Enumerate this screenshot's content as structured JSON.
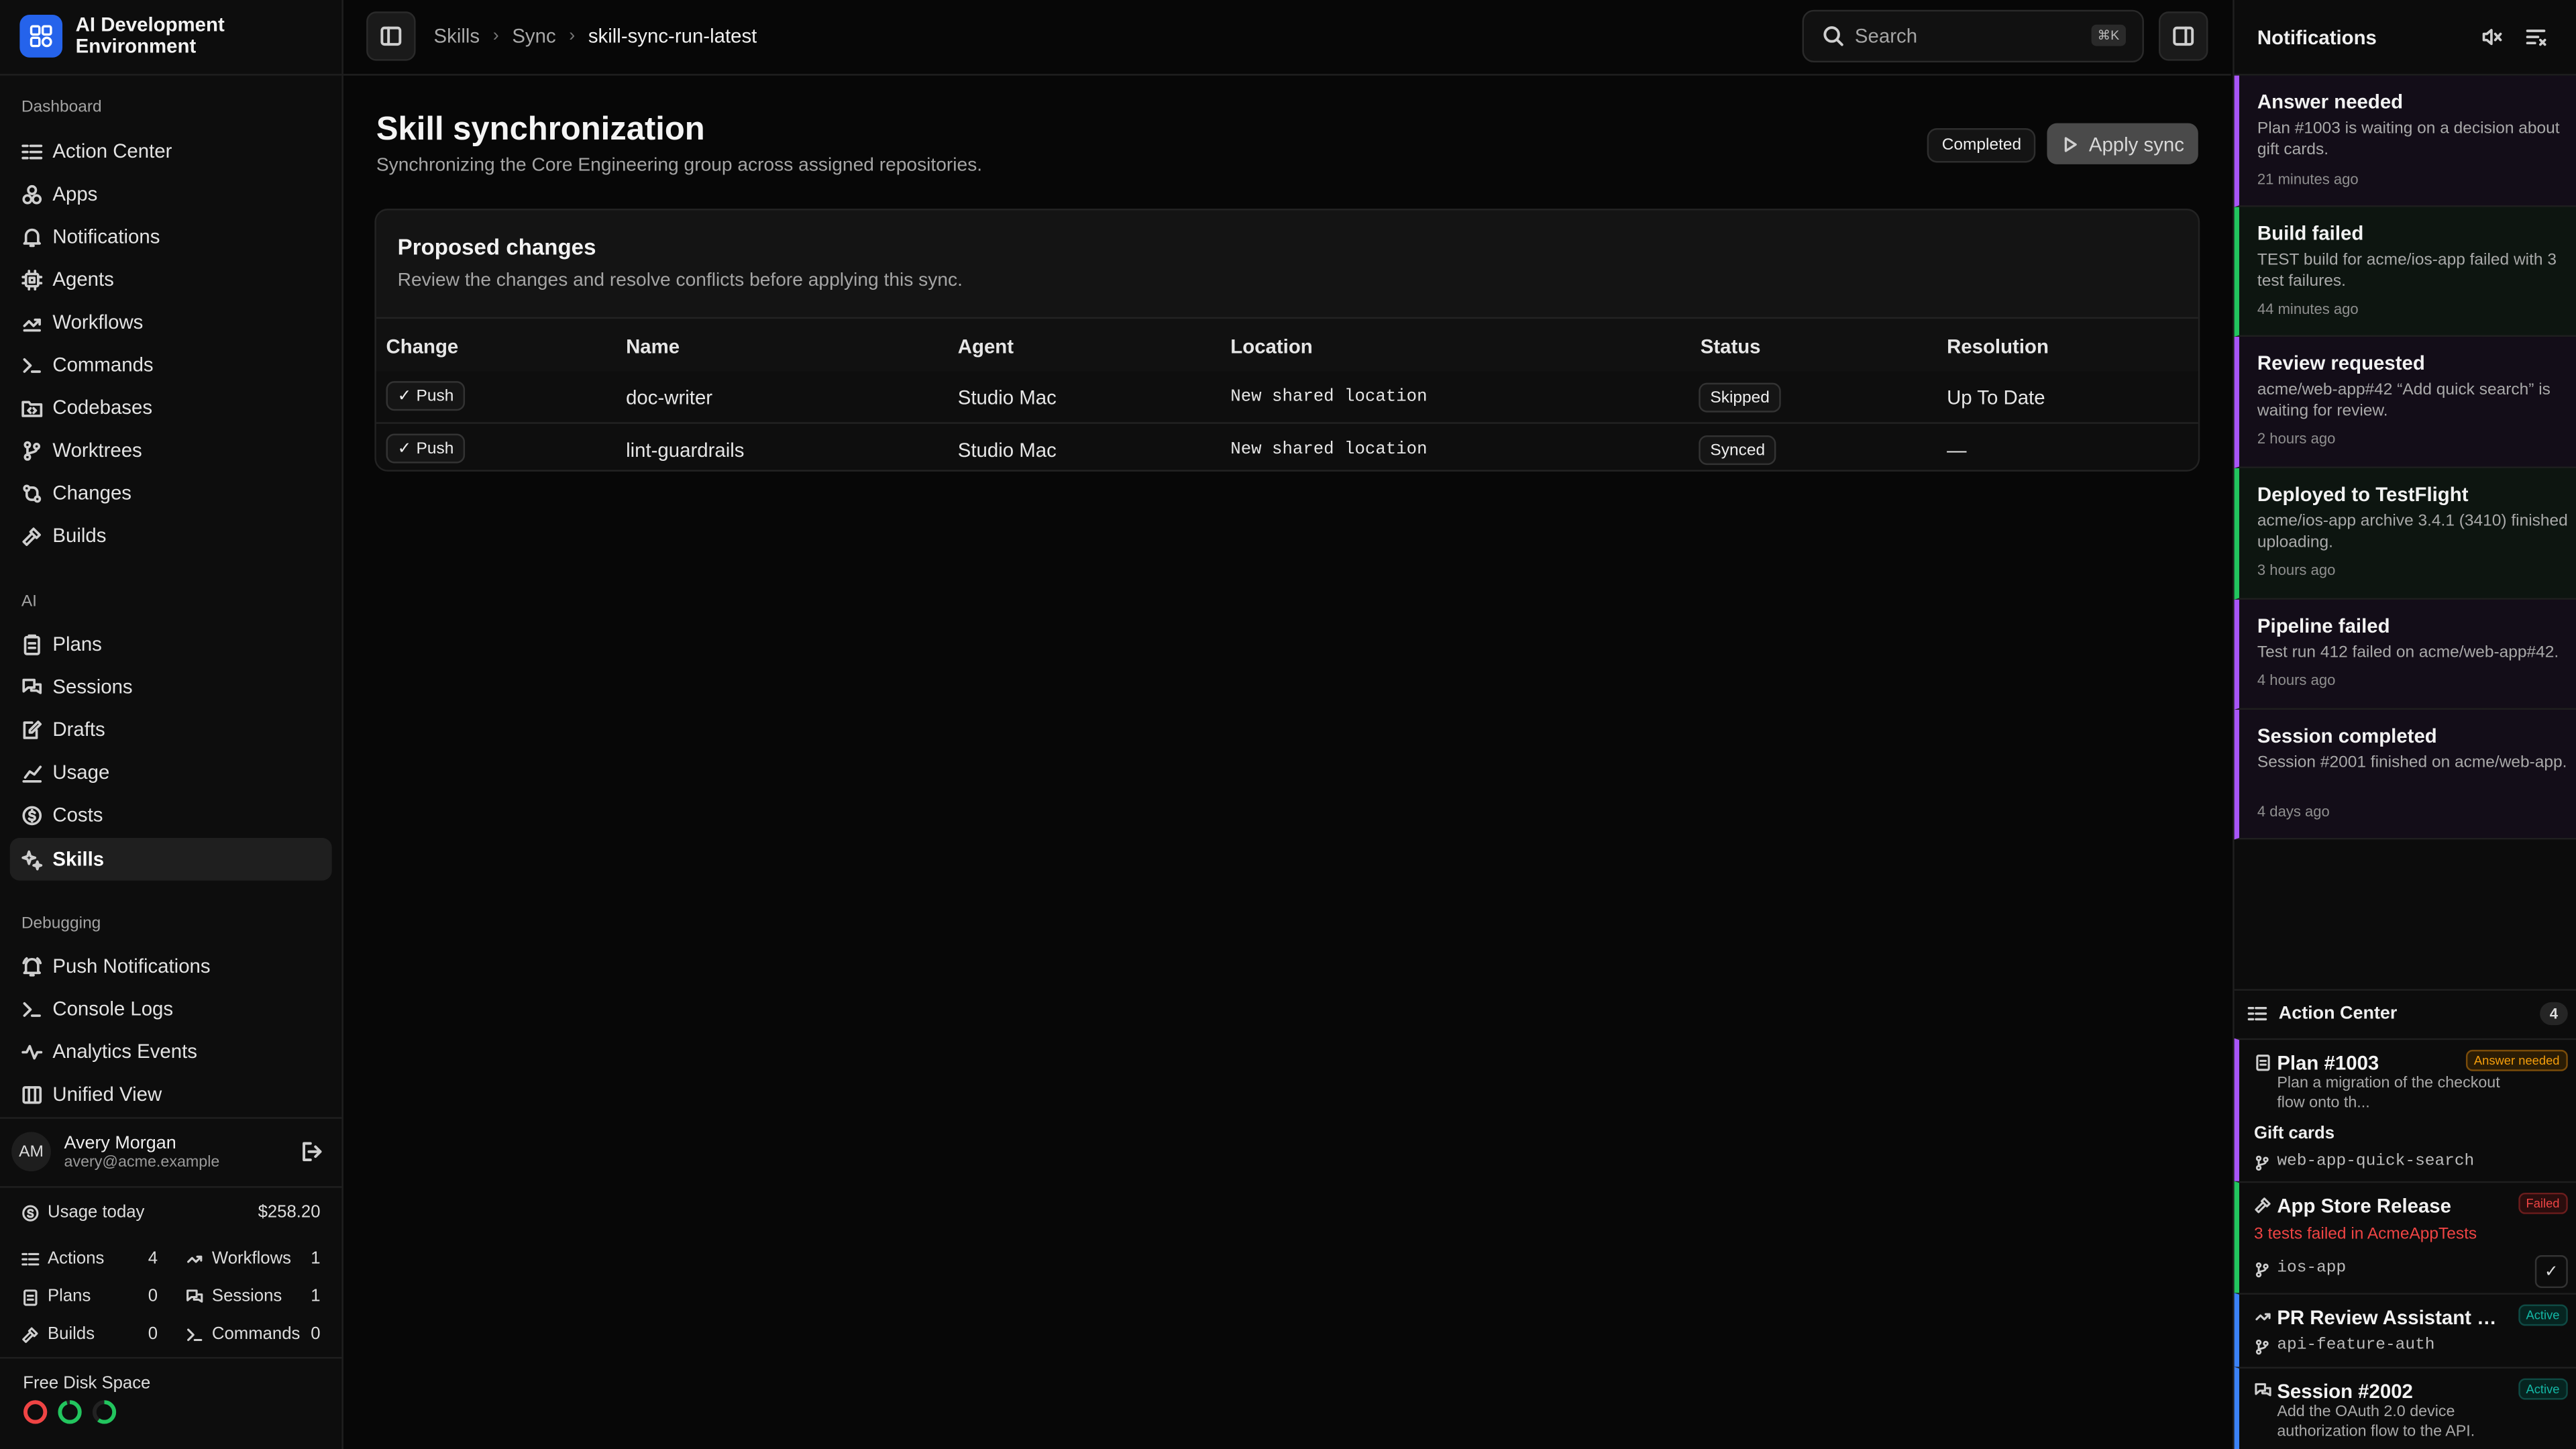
{
  "app": {
    "name": "AI Development Environment"
  },
  "sidebar": {
    "sections": [
      {
        "label": "Dashboard",
        "items": [
          "Action Center",
          "Apps",
          "Notifications",
          "Agents",
          "Workflows",
          "Commands",
          "Codebases",
          "Worktrees",
          "Changes",
          "Builds"
        ]
      },
      {
        "label": "AI",
        "items": [
          "Plans",
          "Sessions",
          "Drafts",
          "Usage",
          "Costs",
          "Skills"
        ]
      },
      {
        "label": "Debugging",
        "items": [
          "Push Notifications",
          "Console Logs",
          "Analytics Events",
          "Unified View"
        ]
      }
    ],
    "active": "Skills"
  },
  "user": {
    "initials": "AM",
    "name": "Avery Morgan",
    "email": "avery@acme.example"
  },
  "usage": {
    "label": "Usage today",
    "value": "$258.20",
    "stats": [
      {
        "label": "Actions",
        "value": "4"
      },
      {
        "label": "Workflows",
        "value": "1"
      },
      {
        "label": "Plans",
        "value": "0"
      },
      {
        "label": "Sessions",
        "value": "1"
      },
      {
        "label": "Builds",
        "value": "0"
      },
      {
        "label": "Commands",
        "value": "0"
      }
    ]
  },
  "disk": {
    "label": "Free Disk Space",
    "rings": [
      {
        "color": "#ef4444",
        "fraction": 1.0
      },
      {
        "color": "#22c55e",
        "fraction": 0.95
      },
      {
        "color": "#22c55e",
        "fraction": 0.6
      }
    ]
  },
  "breadcrumbs": [
    "Skills",
    "Sync",
    "skill-sync-run-latest"
  ],
  "search": {
    "placeholder": "Search",
    "shortcut": "⌘K"
  },
  "page": {
    "title": "Skill synchronization",
    "subtitle": "Synchronizing the Core Engineering group across assigned repositories.",
    "status": "Completed",
    "apply_label": "Apply sync"
  },
  "changes": {
    "title": "Proposed changes",
    "description": "Review the changes and resolve conflicts before applying this sync.",
    "columns": [
      "Change",
      "Name",
      "Agent",
      "Location",
      "Status",
      "Resolution"
    ],
    "rows": [
      {
        "change": "Push",
        "name": "doc-writer",
        "agent": "Studio Mac",
        "location": "New shared location",
        "status": "Skipped",
        "resolution": "Up To Date"
      },
      {
        "change": "Push",
        "name": "lint-guardrails",
        "agent": "Studio Mac",
        "location": "New shared location",
        "status": "Synced",
        "resolution": "—"
      }
    ]
  },
  "notifications": {
    "title": "Notifications",
    "items": [
      {
        "title": "Answer needed",
        "desc": "Plan #1003 is waiting on a decision about gift cards.",
        "age": "21 minutes ago",
        "color": "#a855f7"
      },
      {
        "title": "Build failed",
        "desc": "TEST build for acme/ios-app failed with 3 test failures.",
        "age": "44 minutes ago",
        "color": "#22c55e"
      },
      {
        "title": "Review requested",
        "desc": "acme/web-app#42 “Add quick search” is waiting for review.",
        "age": "2 hours ago",
        "color": "#a855f7"
      },
      {
        "title": "Deployed to TestFlight",
        "desc": "acme/ios-app archive 3.4.1 (3410) finished uploading.",
        "age": "3 hours ago",
        "color": "#22c55e"
      },
      {
        "title": "Pipeline failed",
        "desc": "Test run 412 failed on acme/web-app#42.",
        "age": "4 hours ago",
        "color": "#a855f7"
      },
      {
        "title": "Session completed",
        "desc": "Session #2001 finished on acme/web-app.",
        "age": "4 days ago",
        "color": "#a855f7"
      }
    ]
  },
  "action_center": {
    "title": "Action Center",
    "count": "4",
    "items": [
      {
        "title": "Plan #1003",
        "desc": "Plan a migration of the checkout flow onto th...",
        "extra": "Gift cards",
        "branch": "web-app-quick-search",
        "tag": "Answer needed",
        "tag_color": "#f59e0b",
        "color": "#a855f7"
      },
      {
        "title": "App Store Release",
        "desc": "3 tests failed in AcmeAppTests",
        "branch": "ios-app",
        "tag": "Failed",
        "tag_color": "#ef4444",
        "color": "#22c55e"
      },
      {
        "title": "PR Review Assistant #4...",
        "branch": "api-feature-auth",
        "tag": "Active",
        "tag_color": "#14b8a6",
        "color": "#3b82f6"
      },
      {
        "title": "Session #2002",
        "desc": "Add the OAuth 2.0 device authorization flow to the API.",
        "tag": "Active",
        "tag_color": "#14b8a6",
        "color": "#3b82f6"
      }
    ]
  }
}
